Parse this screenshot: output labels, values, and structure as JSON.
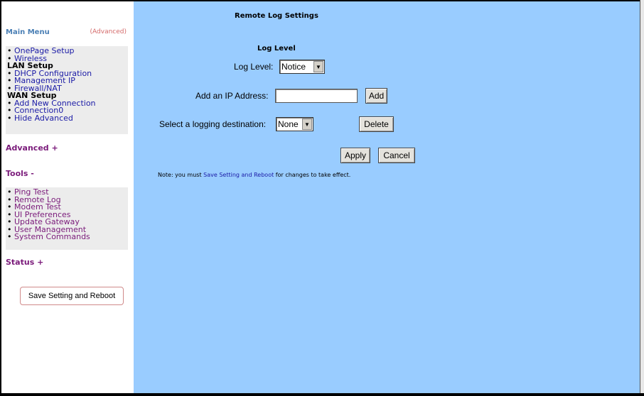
{
  "sidebar": {
    "main_menu_title": "Main Menu",
    "advanced_toggle": "(Advanced)",
    "main_items": [
      {
        "type": "item",
        "label": "OnePage Setup"
      },
      {
        "type": "item",
        "label": "Wireless"
      },
      {
        "type": "header",
        "label": "LAN Setup"
      },
      {
        "type": "item",
        "label": "DHCP Configuration"
      },
      {
        "type": "item",
        "label": "Management IP"
      },
      {
        "type": "item",
        "label": "Firewall/NAT"
      },
      {
        "type": "header",
        "label": "WAN Setup"
      },
      {
        "type": "item",
        "label": "Add New Connection"
      },
      {
        "type": "item",
        "label": "Connection0"
      },
      {
        "type": "item",
        "label": "Hide Advanced"
      }
    ],
    "advanced_section": "Advanced +",
    "tools_section": "Tools -",
    "tools_items": [
      "Ping Test",
      "Remote Log",
      "Modem Test",
      "UI Preferences",
      "Update Gateway",
      "User Management",
      "System Commands"
    ],
    "status_section": "Status +",
    "save_reboot_button": "Save Setting and Reboot"
  },
  "main": {
    "title": "Remote Log Settings",
    "log_level_heading": "Log Level",
    "log_level_label": "Log Level:",
    "log_level_value": "Notice",
    "add_ip_label": "Add an IP Address:",
    "add_ip_value": "",
    "add_button": "Add",
    "destination_label": "Select a logging destination:",
    "destination_value": "None",
    "delete_button": "Delete",
    "apply_button": "Apply",
    "cancel_button": "Cancel",
    "note_prefix": "Note: you must ",
    "note_link": "Save Setting and Reboot",
    "note_suffix": " for changes to take effect."
  },
  "colors": {
    "content_bg": "#99ccff",
    "menu_box_bg": "#ececec",
    "link_blue": "#1a1aa6",
    "section_purple": "#7a1a7a"
  },
  "icons": [
    "dropdown-arrow-icon"
  ]
}
